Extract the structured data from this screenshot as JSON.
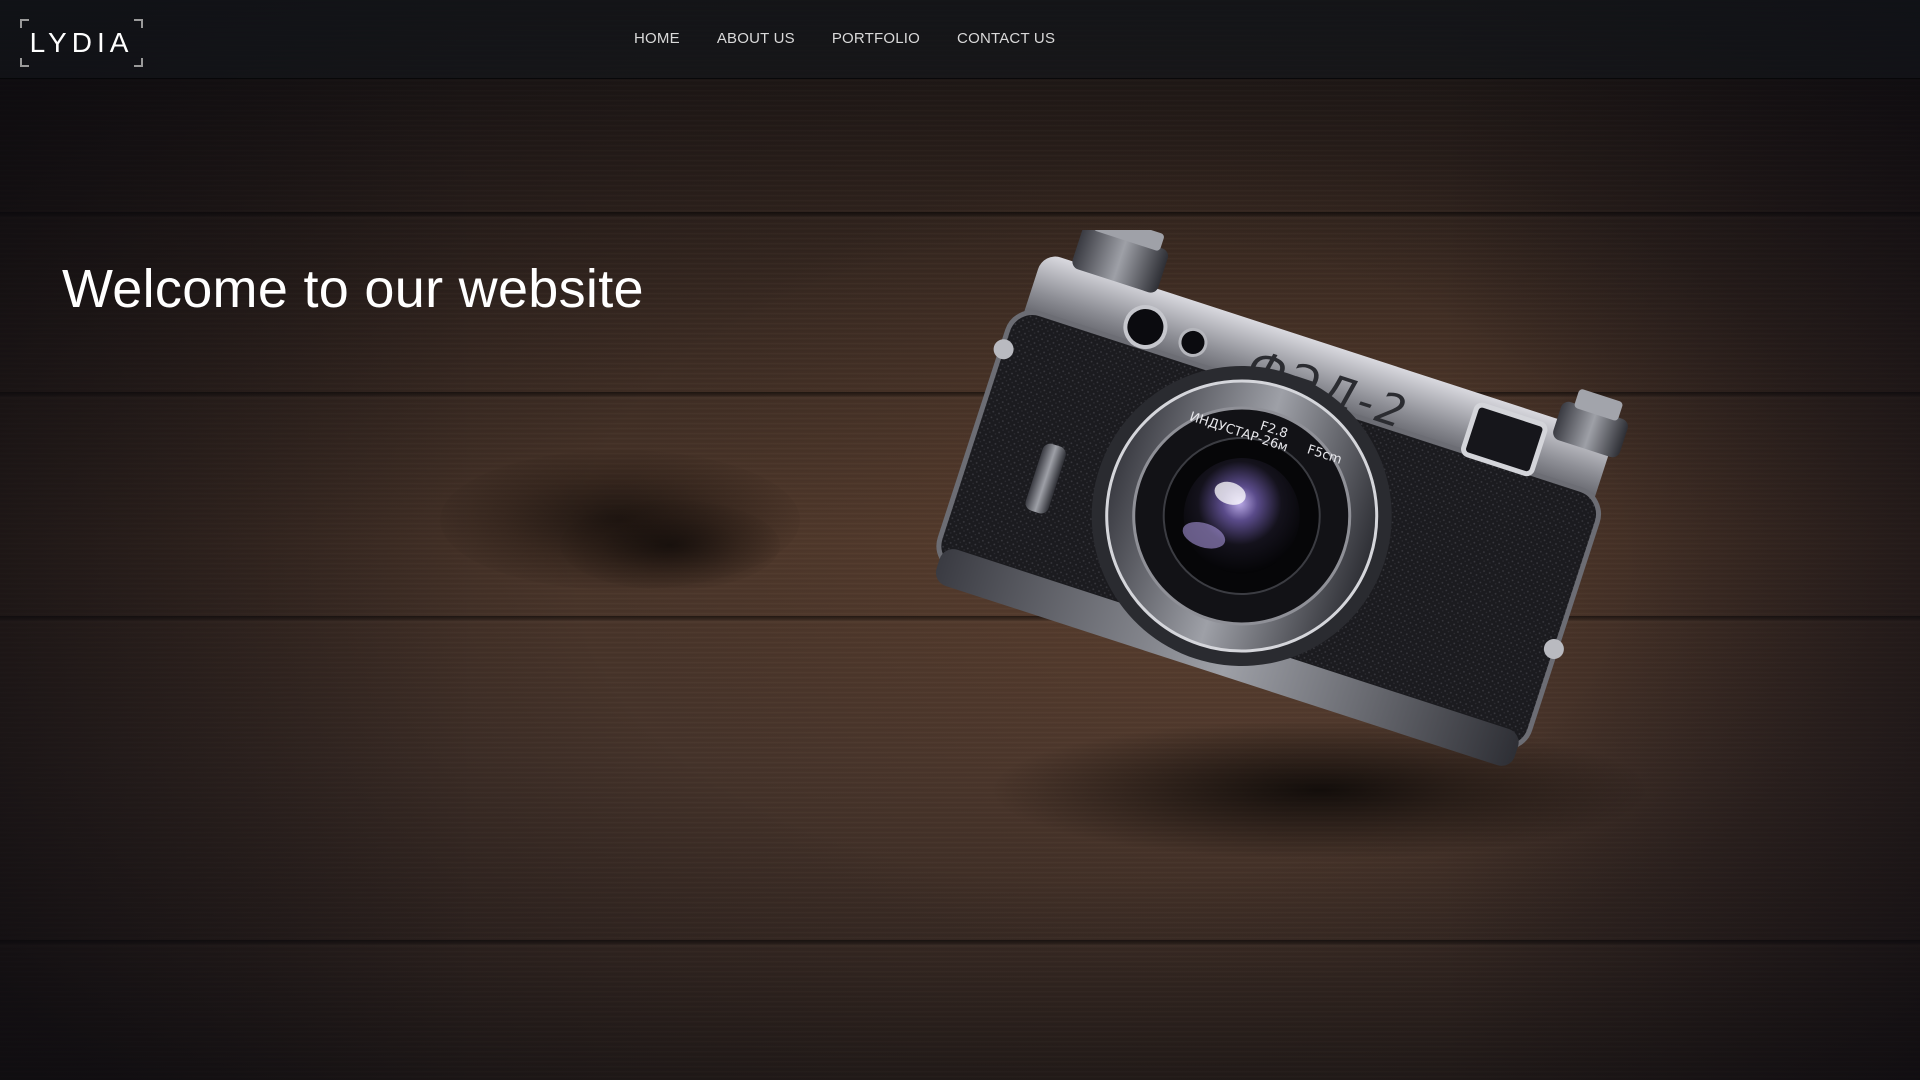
{
  "brand": {
    "logo_text": "LYDIA"
  },
  "nav": {
    "items": [
      {
        "label": "HOME"
      },
      {
        "label": "ABOUT US"
      },
      {
        "label": "PORTFOLIO"
      },
      {
        "label": "CONTACT US"
      }
    ]
  },
  "hero": {
    "title": "Welcome to our website",
    "image_subject": "vintage rangefinder camera on dark wooden table",
    "camera_model_text": "ФЭД-2",
    "lens_text_1": "ИНДУСТАР-26м",
    "lens_text_2": "F2.8",
    "lens_text_3": "F5cm"
  },
  "colors": {
    "header_bg": "#14161c",
    "nav_text": "#d9d9d9",
    "hero_text": "#ffffff",
    "wood_dark": "#2a1f1a",
    "wood_mid": "#4a3529"
  }
}
